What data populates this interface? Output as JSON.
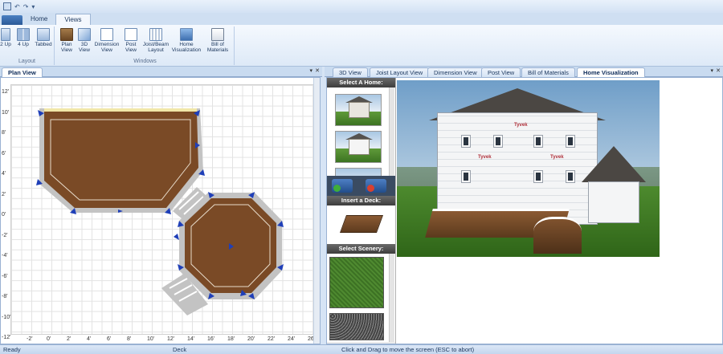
{
  "ribbon_tabs": [
    "Home",
    "Views"
  ],
  "active_ribbon_tab": "Views",
  "groups": {
    "layout": {
      "label": "Layout",
      "buttons": [
        {
          "label": "2 Up",
          "icon": "two-up-icon"
        },
        {
          "label": "4 Up",
          "icon": "four-up-icon"
        },
        {
          "label": "Tabbed",
          "icon": "tabbed-icon"
        }
      ]
    },
    "windows": {
      "label": "Windows",
      "buttons": [
        {
          "label": "Plan View",
          "icon": "plan-view-icon"
        },
        {
          "label": "3D View",
          "icon": "cube-icon"
        },
        {
          "label": "Dimension View",
          "icon": "dimension-icon"
        },
        {
          "label": "Post View",
          "icon": "post-icon"
        },
        {
          "label": "Joist/Beam Layout",
          "icon": "joist-icon"
        },
        {
          "label": "Home Visualization",
          "icon": "home-icon"
        },
        {
          "label": "Bill of Materials",
          "icon": "document-icon"
        }
      ]
    }
  },
  "plan_panel": {
    "tab": "Plan View",
    "y_ticks": [
      "12'",
      "10'",
      "8'",
      "6'",
      "4'",
      "2'",
      "0'",
      "-2'",
      "-4'",
      "-6'",
      "-8'",
      "-10'",
      "-12'"
    ],
    "x_ticks": [
      "-2'",
      "0'",
      "2'",
      "4'",
      "6'",
      "8'",
      "10'",
      "12'",
      "14'",
      "16'",
      "18'",
      "20'",
      "22'",
      "24'",
      "26'"
    ]
  },
  "right_panel": {
    "tabs": [
      "3D View",
      "Joist Layout View",
      "Dimension View",
      "Post View",
      "Bill of Materials",
      "Home Visualization"
    ],
    "active_tab": "Home Visualization",
    "sidebar": {
      "select_home": "Select A Home:",
      "insert_deck": "Insert a Deck:",
      "select_scenery": "Select Scenery:"
    },
    "house_wrap_label": "Tyvek"
  },
  "status": {
    "left": "Ready",
    "middle": "Deck",
    "right": "Click and Drag to move the screen  (ESC to abort)"
  },
  "colors": {
    "deck": "#7a4a26",
    "deck_border": "#b8b8b8",
    "handle": "#1f3fb8",
    "active_tab_text": "#0d2b59"
  }
}
